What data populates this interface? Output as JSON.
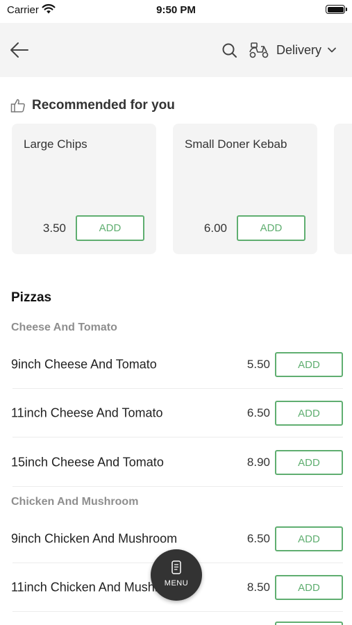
{
  "status_bar": {
    "carrier": "Carrier",
    "time": "9:50 PM"
  },
  "header": {
    "back_icon": "arrow-left-icon",
    "search_icon": "search-icon",
    "delivery_icon": "scooter-icon",
    "delivery_label": "Delivery",
    "dropdown_icon": "chevron-down-icon"
  },
  "recommended": {
    "title": "Recommended for you",
    "icon": "thumbs-up-icon",
    "items": [
      {
        "name": "Large Chips",
        "price": "3.50",
        "add_label": "ADD"
      },
      {
        "name": "Small Doner Kebab",
        "price": "6.00",
        "add_label": "ADD"
      }
    ]
  },
  "section": {
    "title": "Pizzas",
    "subcategories": [
      {
        "name": "Cheese And Tomato",
        "items": [
          {
            "name": "9inch Cheese And Tomato",
            "price": "5.50",
            "add_label": "ADD"
          },
          {
            "name": "11inch Cheese And Tomato",
            "price": "6.50",
            "add_label": "ADD"
          },
          {
            "name": "15inch Cheese And Tomato",
            "price": "8.90",
            "add_label": "ADD"
          }
        ]
      },
      {
        "name": "Chicken And Mushroom",
        "items": [
          {
            "name": "9inch Chicken And Mushroom",
            "price": "6.50",
            "add_label": "ADD"
          },
          {
            "name": "11inch Chicken And Mushroom",
            "price": "8.50",
            "add_label": "ADD"
          }
        ]
      }
    ]
  },
  "menu_button": {
    "label": "MENU",
    "icon": "menu-book-icon"
  },
  "colors": {
    "accent": "#5fae70",
    "header_bg": "#f4f4f4",
    "card_bg": "#f4f4f4",
    "fab_bg": "#333333"
  }
}
